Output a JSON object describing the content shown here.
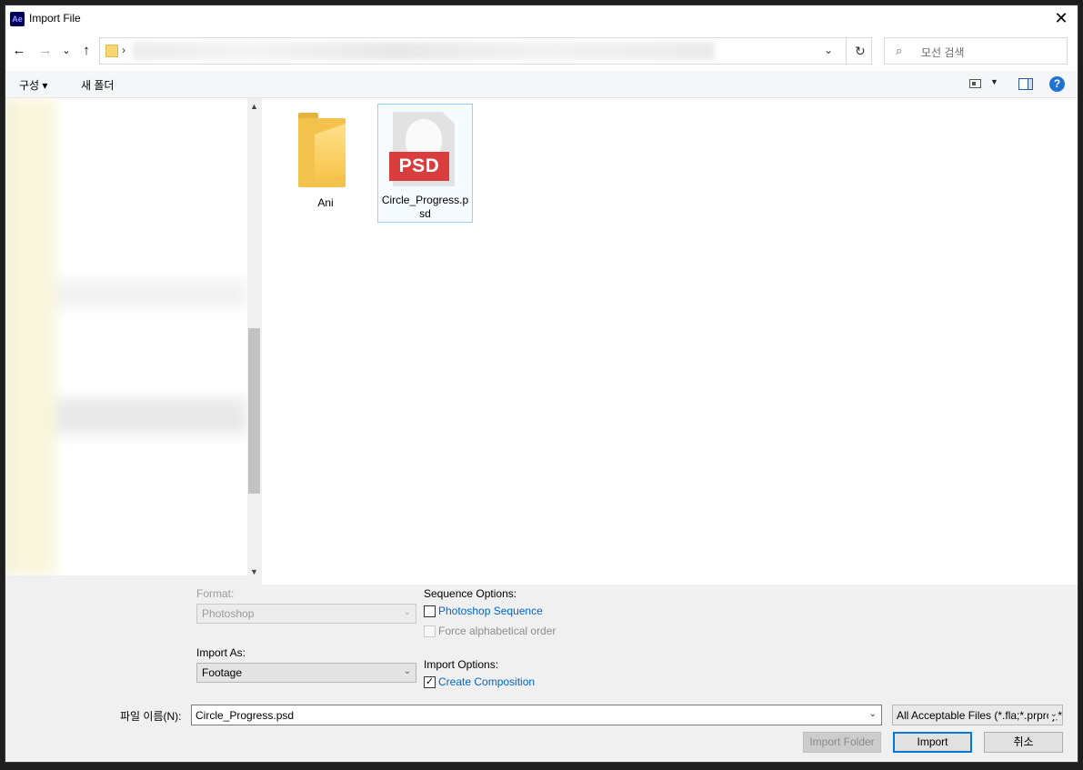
{
  "window": {
    "title": "Import File",
    "app_logo": "Ae"
  },
  "nav": {
    "back": "←",
    "forward": "→",
    "recent": "⌄",
    "up": "↑",
    "sep": "›",
    "dropdown": "⌄",
    "refresh": "↻"
  },
  "search": {
    "placeholder": "모선 검색",
    "icon": "⌕"
  },
  "toolbar": {
    "organize": "구성 ▾",
    "new_folder": "새 폴더",
    "view_dd": "▼",
    "help": "?"
  },
  "files": [
    {
      "name": "Ani",
      "type": "folder"
    },
    {
      "name_line1": "Circle_Progress.p",
      "name_line2": "sd",
      "type": "psd",
      "badge": "PSD",
      "selected": true
    }
  ],
  "options": {
    "format_label": "Format:",
    "format_value": "Photoshop",
    "import_as_label": "Import As:",
    "import_as_value": "Footage",
    "sequence_label": "Sequence Options:",
    "photoshop_sequence": "Photoshop Sequence",
    "force_alpha": "Force alphabetical order",
    "import_options_label": "Import Options:",
    "create_composition": "Create Composition",
    "create_composition_checked": "✓"
  },
  "filename": {
    "label": "파일 이름(N):",
    "value": "Circle_Progress.psd"
  },
  "filter": {
    "value": "All Acceptable Files (*.fla;*.prproj;*.aep"
  },
  "buttons": {
    "import_folder": "Import Folder",
    "import": "Import",
    "cancel": "취소"
  },
  "glyphs": {
    "close": "✕",
    "dropdown": "⌄"
  }
}
